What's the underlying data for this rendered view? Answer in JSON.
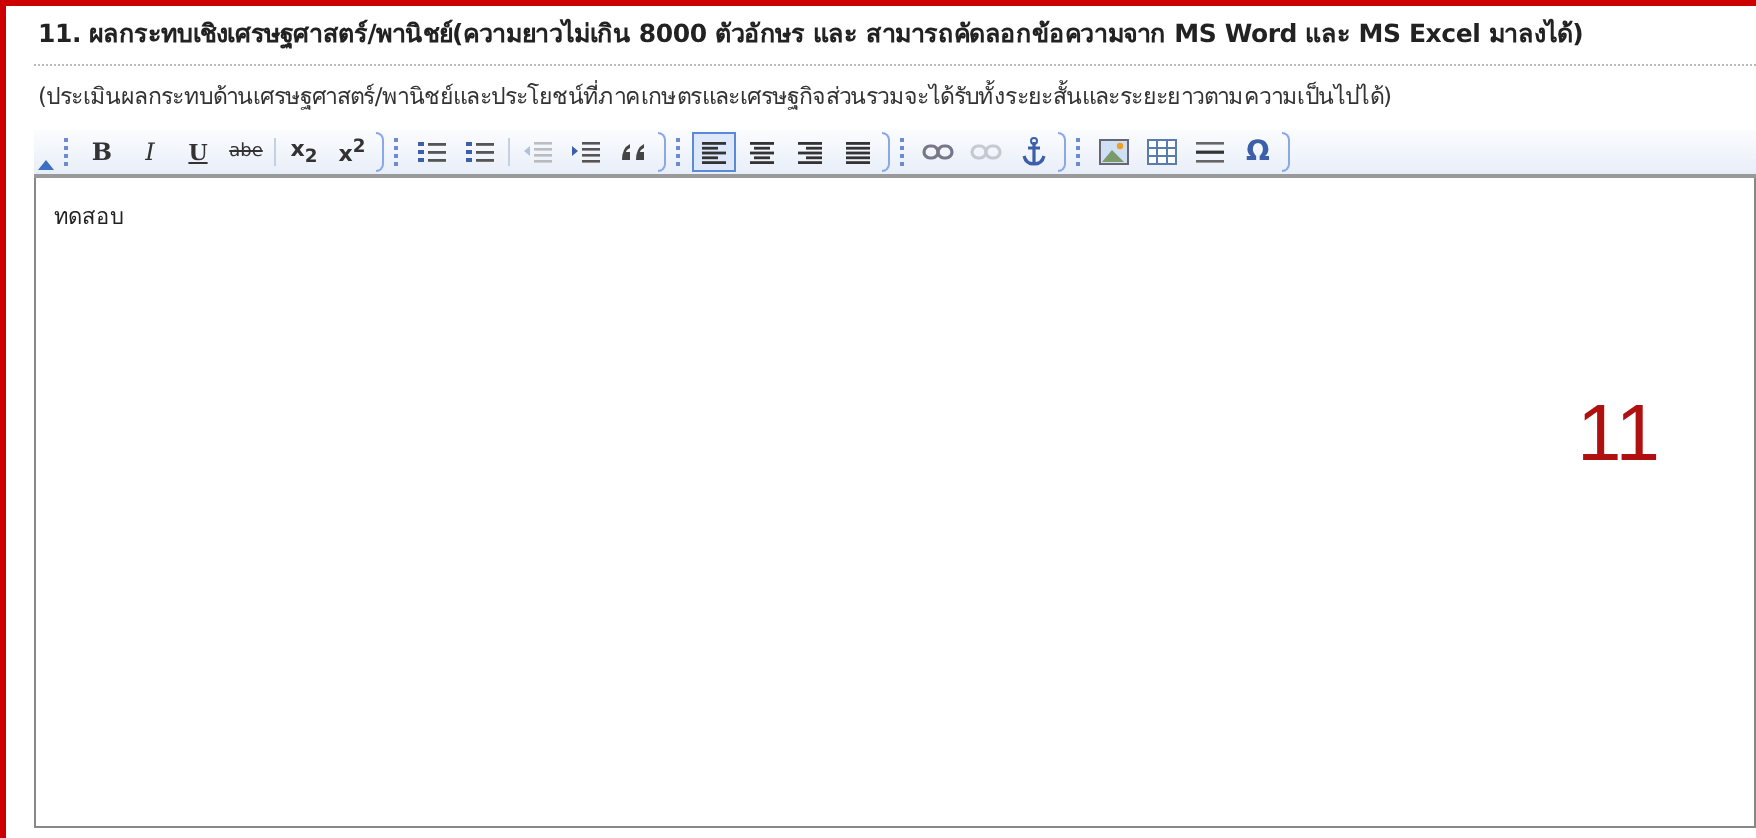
{
  "heading": "11. ผลกระทบเชิงเศรษฐศาสตร์/พานิชย์(ความยาวไม่เกิน 8000 ตัวอักษร และ สามารถคัดลอกข้อความจาก MS Word และ MS Excel มาลงได้)",
  "hint": "(ประเมินผลกระทบด้านเศรษฐศาสตร์/พานิชย์และประโยชน์ที่ภาคเกษตรและเศรษฐกิจส่วนรวมจะได้รับทั้งระยะสั้นและระยะยาวตามความเป็นไปได้)",
  "toolbar": [
    [
      {
        "kind": "bold",
        "glyph": "B",
        "disabled": false,
        "selected": false
      },
      {
        "kind": "italic",
        "glyph": "I",
        "disabled": false,
        "selected": false
      },
      {
        "kind": "underline",
        "glyph": "U",
        "disabled": false,
        "selected": false
      },
      {
        "kind": "strike",
        "glyph": "abe",
        "disabled": false,
        "selected": false
      },
      {
        "kind": "subscript",
        "glyph": "x$_{2}$",
        "disabled": false,
        "selected": false
      },
      {
        "kind": "superscript",
        "glyph": "x$^{2}$",
        "disabled": false,
        "selected": false
      }
    ],
    [
      {
        "kind": "numbered-list",
        "disabled": false,
        "selected": false
      },
      {
        "kind": "bulleted-list",
        "disabled": false,
        "selected": false
      },
      {
        "kind": "outdent",
        "disabled": true,
        "selected": false
      },
      {
        "kind": "indent",
        "disabled": false,
        "selected": false
      },
      {
        "kind": "quote",
        "disabled": false,
        "selected": false
      }
    ],
    [
      {
        "kind": "align-left",
        "disabled": false,
        "selected": true
      },
      {
        "kind": "align-center",
        "disabled": false,
        "selected": false
      },
      {
        "kind": "align-right",
        "disabled": false,
        "selected": false
      },
      {
        "kind": "justify",
        "disabled": false,
        "selected": false
      }
    ],
    [
      {
        "kind": "link",
        "disabled": false,
        "selected": false
      },
      {
        "kind": "unlink",
        "disabled": true,
        "selected": false
      },
      {
        "kind": "anchor",
        "disabled": false,
        "selected": false
      }
    ],
    [
      {
        "kind": "image",
        "disabled": false,
        "selected": false
      },
      {
        "kind": "table",
        "disabled": false,
        "selected": false
      },
      {
        "kind": "horizontal-rule",
        "disabled": false,
        "selected": false
      },
      {
        "kind": "special-char",
        "glyph": "Ω",
        "disabled": false,
        "selected": false
      }
    ]
  ],
  "editor_text": "ทดสอบ",
  "annotation": "11"
}
